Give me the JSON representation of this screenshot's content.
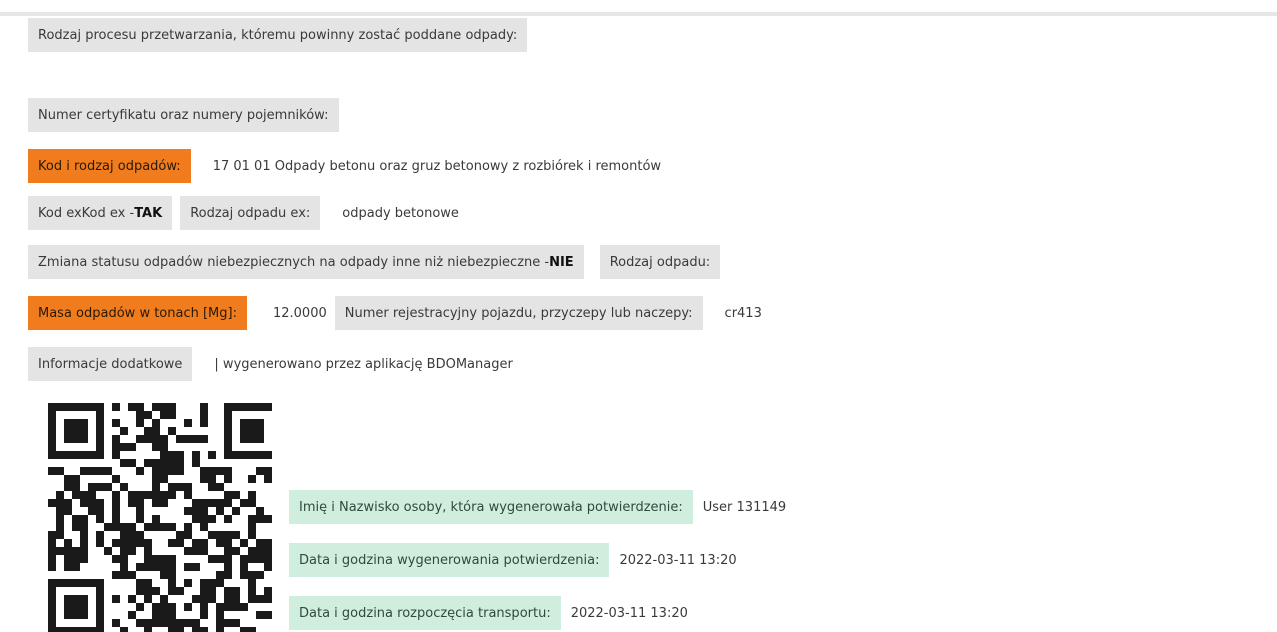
{
  "form": {
    "process_type_label": "Rodzaj procesu przetwarzania, któremu powinny zostać poddane odpady:",
    "certificate_label": "Numer certyfikatu oraz numery pojemników:",
    "waste_code_label": "Kod i rodzaj odpadów:",
    "waste_code_value": "17 01 01 Odpady betonu oraz gruz betonowy z rozbiórek i remontów",
    "ex_code_label": "Kod exKod ex - ",
    "ex_code_value": "TAK",
    "ex_waste_type_label": "Rodzaj odpadu ex:",
    "ex_waste_type_value": "odpady betonowe",
    "hazard_change_label": "Zmiana statusu odpadów niebezpiecznych na odpady inne niż niebezpieczne - ",
    "hazard_change_value": "NIE",
    "waste_type_label": "Rodzaj odpadu:",
    "mass_label": "Masa odpadów w tonach [Mg]:",
    "mass_value": "12.0000",
    "vehicle_label": "Numer rejestracyjny pojazdu, przyczepy lub naczepy:",
    "vehicle_value": "cr413",
    "additional_info_label": "Informacje dodatkowe",
    "additional_info_value": "| wygenerowano przez aplikację BDOManager"
  },
  "confirmation": {
    "generated_by_label": "Imię i Nazwisko osoby, która wygenerowała potwierdzenie:",
    "generated_by_value": "User 131149",
    "generated_at_label": "Data i godzina wygenerowania potwierdzenia:",
    "generated_at_value": "2022-03-11 13:20",
    "transport_start_label": "Data i godzina rozpoczęcia transportu:",
    "transport_start_value": "2022-03-11 13:20"
  },
  "colors": {
    "orange": "#f07c1e",
    "green": "#cfeede",
    "grey": "#e4e4e4"
  },
  "icons": {
    "qr": "qr-code-icon"
  }
}
